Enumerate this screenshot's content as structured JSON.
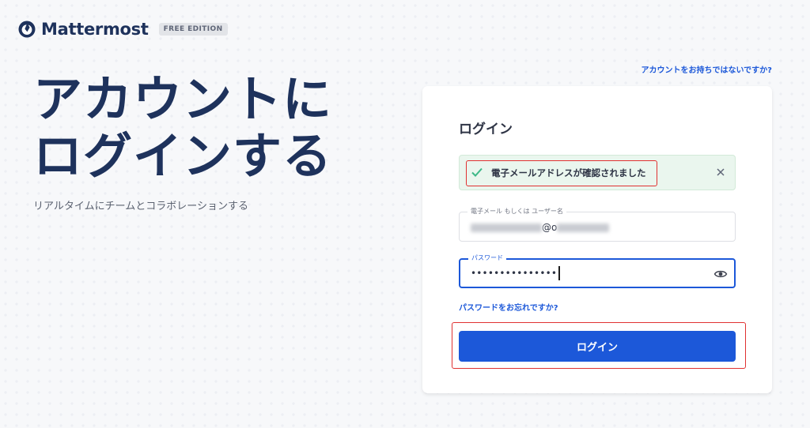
{
  "header": {
    "logo_text": "Mattermost",
    "edition_badge": "FREE EDITION",
    "logo_icon": "mattermost-logo-icon"
  },
  "signup_link": "アカウントをお持ちではないですか?",
  "hero": {
    "title": "アカウントにログインする",
    "subtitle": "リアルタイムにチームとコラボレーションする"
  },
  "login_card": {
    "title": "ログイン",
    "banner": {
      "icon": "check-icon",
      "text": "電子メールアドレスが確認されました",
      "close_icon": "close-icon"
    },
    "email_field": {
      "label": "電子メール もしくは ユーザー名",
      "visible_fragment": "@o"
    },
    "password_field": {
      "label": "パスワード",
      "masked_value": "•••••••••••••••",
      "toggle_icon": "eye-icon"
    },
    "forgot_link": "パスワードをお忘れですか?",
    "login_button": "ログイン"
  },
  "colors": {
    "brand_navy": "#1e325c",
    "accent_blue": "#1c58d9",
    "success_bg": "#eaf6ee",
    "success_check": "#3db887",
    "annotation_red": "#e03131"
  }
}
